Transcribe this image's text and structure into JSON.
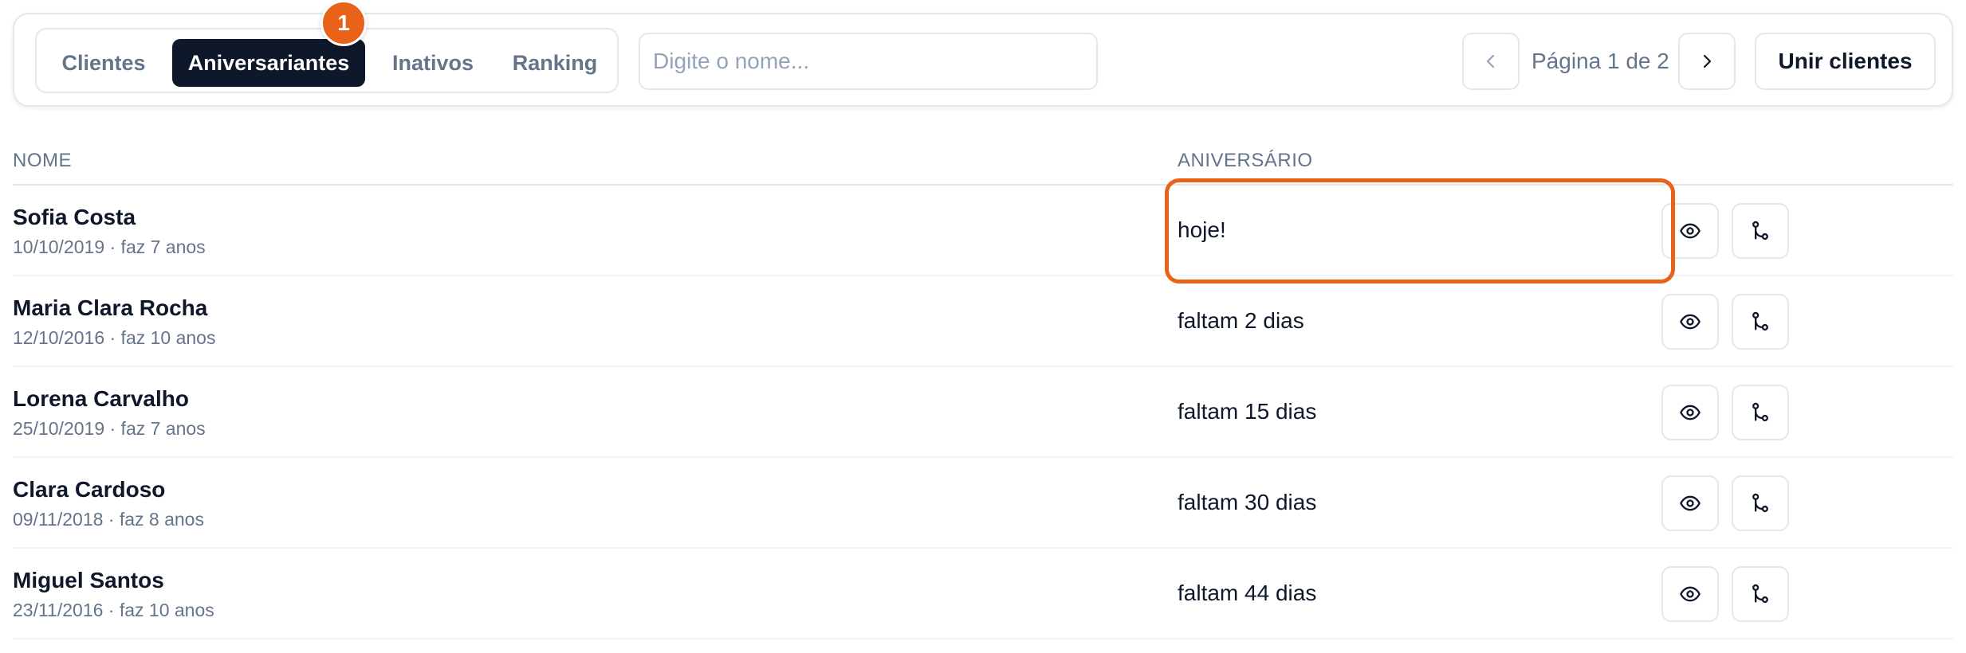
{
  "tabs": [
    {
      "label": "Clientes"
    },
    {
      "label": "Aniversariantes",
      "active": true
    },
    {
      "label": "Inativos"
    },
    {
      "label": "Ranking"
    }
  ],
  "badge": {
    "count": "1",
    "color": "#e8621a"
  },
  "search": {
    "placeholder": "Digite o nome...",
    "value": ""
  },
  "pagination": {
    "text": "Página 1 de 2",
    "prev_icon": "chevron-left-icon",
    "next_icon": "chevron-right-icon"
  },
  "merge_label": "Unir clientes",
  "table": {
    "headers": {
      "name": "NOME",
      "birthday": "ANIVERSÁRIO"
    },
    "rows": [
      {
        "name": "Sofia Costa",
        "sub": "10/10/2019 · faz 7 anos",
        "birthday": "hoje!"
      },
      {
        "name": "Maria Clara Rocha",
        "sub": "12/10/2016 · faz 10 anos",
        "birthday": "faltam 2 dias"
      },
      {
        "name": "Lorena Carvalho",
        "sub": "25/10/2019 · faz 7 anos",
        "birthday": "faltam 15 dias"
      },
      {
        "name": "Clara Cardoso",
        "sub": "09/11/2018 · faz 8 anos",
        "birthday": "faltam 30 dias"
      },
      {
        "name": "Miguel Santos",
        "sub": "23/11/2016 · faz 10 anos",
        "birthday": "faltam 44 dias"
      }
    ]
  },
  "row_actions": {
    "view_icon": "eye-icon",
    "merge_icon": "merge-icon"
  },
  "colors": {
    "accent": "#e8621a",
    "primary": "#0f172a",
    "muted": "#64748b",
    "border": "#e2e8f0"
  }
}
